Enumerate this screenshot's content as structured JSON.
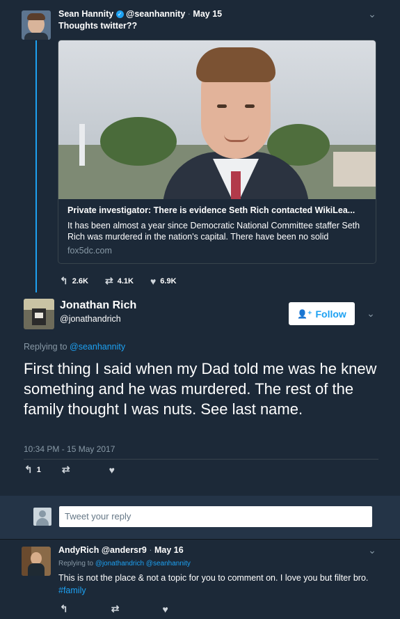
{
  "tweet1": {
    "name": "Sean Hannity",
    "handle": "@seanhannity",
    "date": "May 15",
    "text": "Thoughts twitter??",
    "card": {
      "title": "Private investigator: There is evidence Seth Rich contacted WikiLea...",
      "description": "It has been almost a year since Democratic National Committee staffer Seth Rich was murdered in the nation's capital. There have been no solid",
      "domain": "fox5dc.com"
    },
    "retweets": "2.6K",
    "reply_count": "4.1K",
    "likes": "6.9K"
  },
  "main_tweet": {
    "name": "Jonathan Rich",
    "handle": "@jonathandrich",
    "follow_label": "Follow",
    "replying_prefix": "Replying to",
    "replying_handle": "@seanhannity",
    "text": "First thing I said when my Dad told me was he knew something and he was murdered. The rest of the family thought I was nuts. See last name.",
    "timestamp": "10:34 PM - 15 May 2017",
    "reply_count": "1"
  },
  "reply_box": {
    "placeholder": "Tweet your reply"
  },
  "tweet3": {
    "name": "AndyRich",
    "handle": "@andersr9",
    "date": "May 16",
    "replying_prefix": "Replying to",
    "replying_handle1": "@jonathandrich",
    "replying_handle2": "@seanhannity",
    "text": "This is not the place & not a topic for you to comment on. I love you but filter bro.",
    "hashtag": "#family"
  },
  "colors": {
    "background": "#1c2938",
    "accent": "#1da1f2",
    "muted": "#8899a6"
  }
}
